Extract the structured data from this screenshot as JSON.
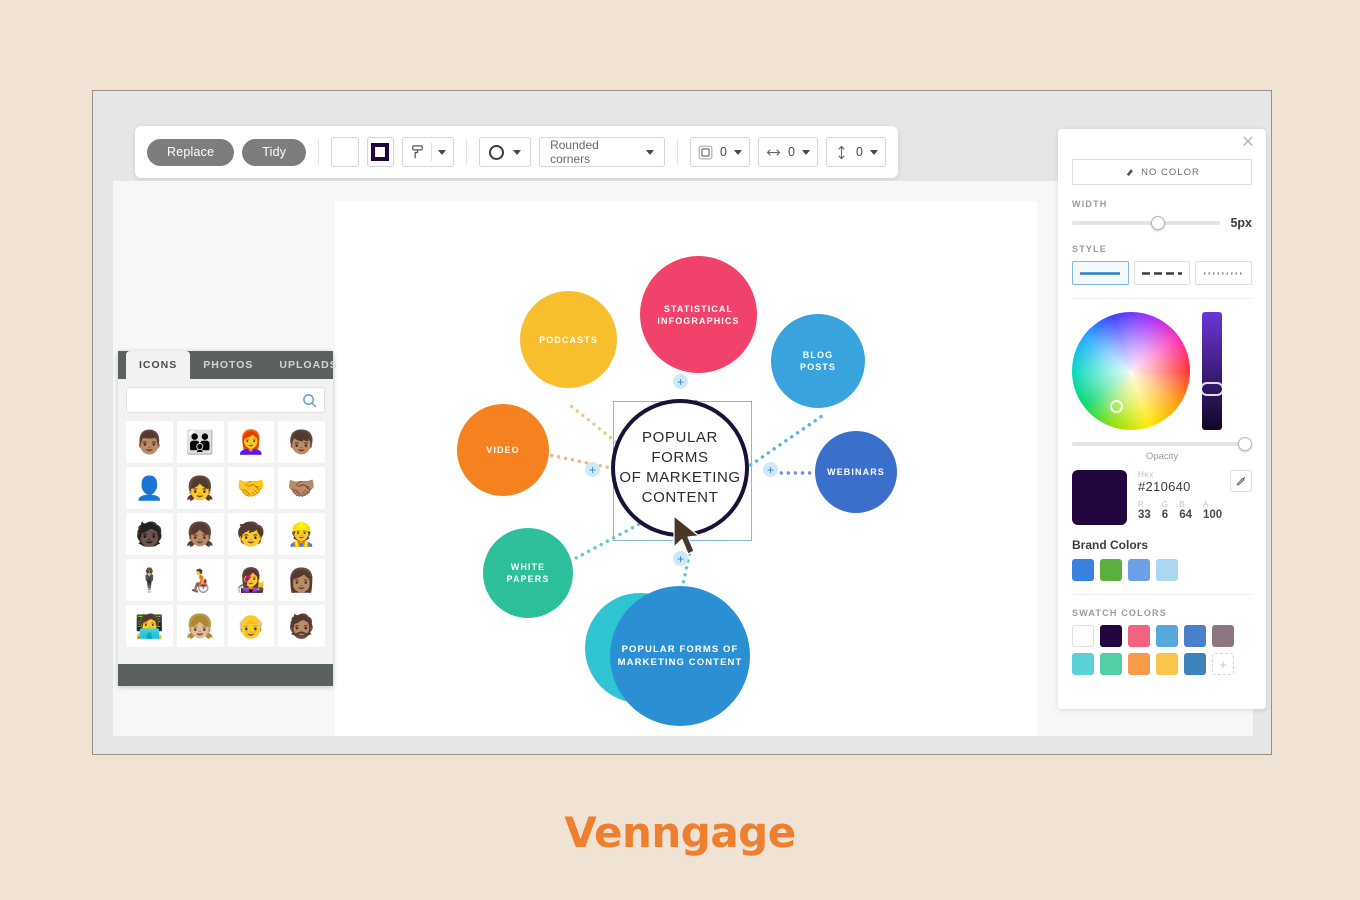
{
  "window": {
    "title": ""
  },
  "toolbar": {
    "replace_label": "Replace",
    "tidy_label": "Tidy",
    "fill_swatch_color": "#ffffff",
    "border_swatch_color": "#210640",
    "paint_icon": "paint-roller-icon",
    "shape_label": "",
    "shape_icon": "circle-outline-icon",
    "corners_label": "Rounded corners",
    "border_radius_value": "0",
    "width_value": "0",
    "height_value": "0",
    "border_icon": "border-box-icon",
    "hspace_icon": "horizontal-arrows-icon",
    "vspace_icon": "vertical-arrows-icon"
  },
  "icons_panel": {
    "tabs": [
      {
        "label": "ICONS",
        "active": true
      },
      {
        "label": "PHOTOS",
        "active": false
      },
      {
        "label": "UPLOADS",
        "active": false
      }
    ],
    "search": {
      "value": "",
      "placeholder": "",
      "icon": "search-icon"
    },
    "grid": [
      "👨🏽",
      "👪",
      "👩‍🦰",
      "👦🏽",
      "👤",
      "👧",
      "🤝",
      "🤝🏽",
      "🧑🏿",
      "👧🏽",
      "🧒",
      "👷",
      "🕴",
      "🧑‍🦽",
      "👩‍🎤",
      "👩🏽",
      "🧑‍💻",
      "👧🏼",
      "👴",
      "🧔🏽"
    ]
  },
  "properties_panel": {
    "close_icon": "close-icon",
    "no_color_label": "NO COLOR",
    "no_color_icon": "no-color-icon",
    "width_label": "WIDTH",
    "width_value": "5px",
    "width_percent": 58,
    "style_label": "STYLE",
    "styles": [
      {
        "name": "solid",
        "active": true
      },
      {
        "name": "dashed",
        "active": false
      },
      {
        "name": "dotted",
        "active": false
      }
    ],
    "opacity_label": "Opacity",
    "opacity_percent": 96,
    "hex_label": "Hex",
    "hex_value": "#210640",
    "preview_color": "#210640",
    "eyedropper_icon": "eyedropper-icon",
    "rgba": [
      {
        "key": "R",
        "value": "33"
      },
      {
        "key": "G",
        "value": "6"
      },
      {
        "key": "B",
        "value": "64"
      },
      {
        "key": "A",
        "value": "100"
      }
    ],
    "brand_colors_title": "Brand Colors",
    "brand_colors": [
      "#3b82e0",
      "#59b040",
      "#6aa0e8",
      "#a9d8f0"
    ],
    "swatch_colors_title": "SWATCH COLORS",
    "swatch_colors": [
      "#ffffff",
      "#210640",
      "#f1637f",
      "#56a8dd",
      "#4a7fcb",
      "#8e7682",
      "#5bd0d8",
      "#53cfa5",
      "#f79a4a",
      "#f8c64a",
      "#3b83b8"
    ],
    "add_swatch_label": "+"
  },
  "diagram": {
    "center": {
      "label": "POPULAR FORMS\nOF MARKETING\nCONTENT"
    },
    "nodes": [
      {
        "label": "STATISTICAL\nINFOGRAPHICS",
        "color": "#f0426b"
      },
      {
        "label": "PODCASTS",
        "color": "#f7bf2e"
      },
      {
        "label": "BLOG\nPOSTS",
        "color": "#38a3dc"
      },
      {
        "label": "VIDEO",
        "color": "#f5821f"
      },
      {
        "label": "WEBINARS",
        "color": "#3a6fcb"
      },
      {
        "label": "WHITE\nPAPERS",
        "color": "#2cbf9a"
      },
      {
        "label": "POPULAR FORMS OF\nMARKETING CONTENT",
        "color": "#2b8fd4"
      }
    ],
    "ghost_node": {
      "color": "#2fc4d1"
    },
    "add_handles": 4,
    "cursor": "pointer-cursor"
  },
  "footer": {
    "logo_text": "Venngage",
    "logo_color": "#ef7f30"
  }
}
